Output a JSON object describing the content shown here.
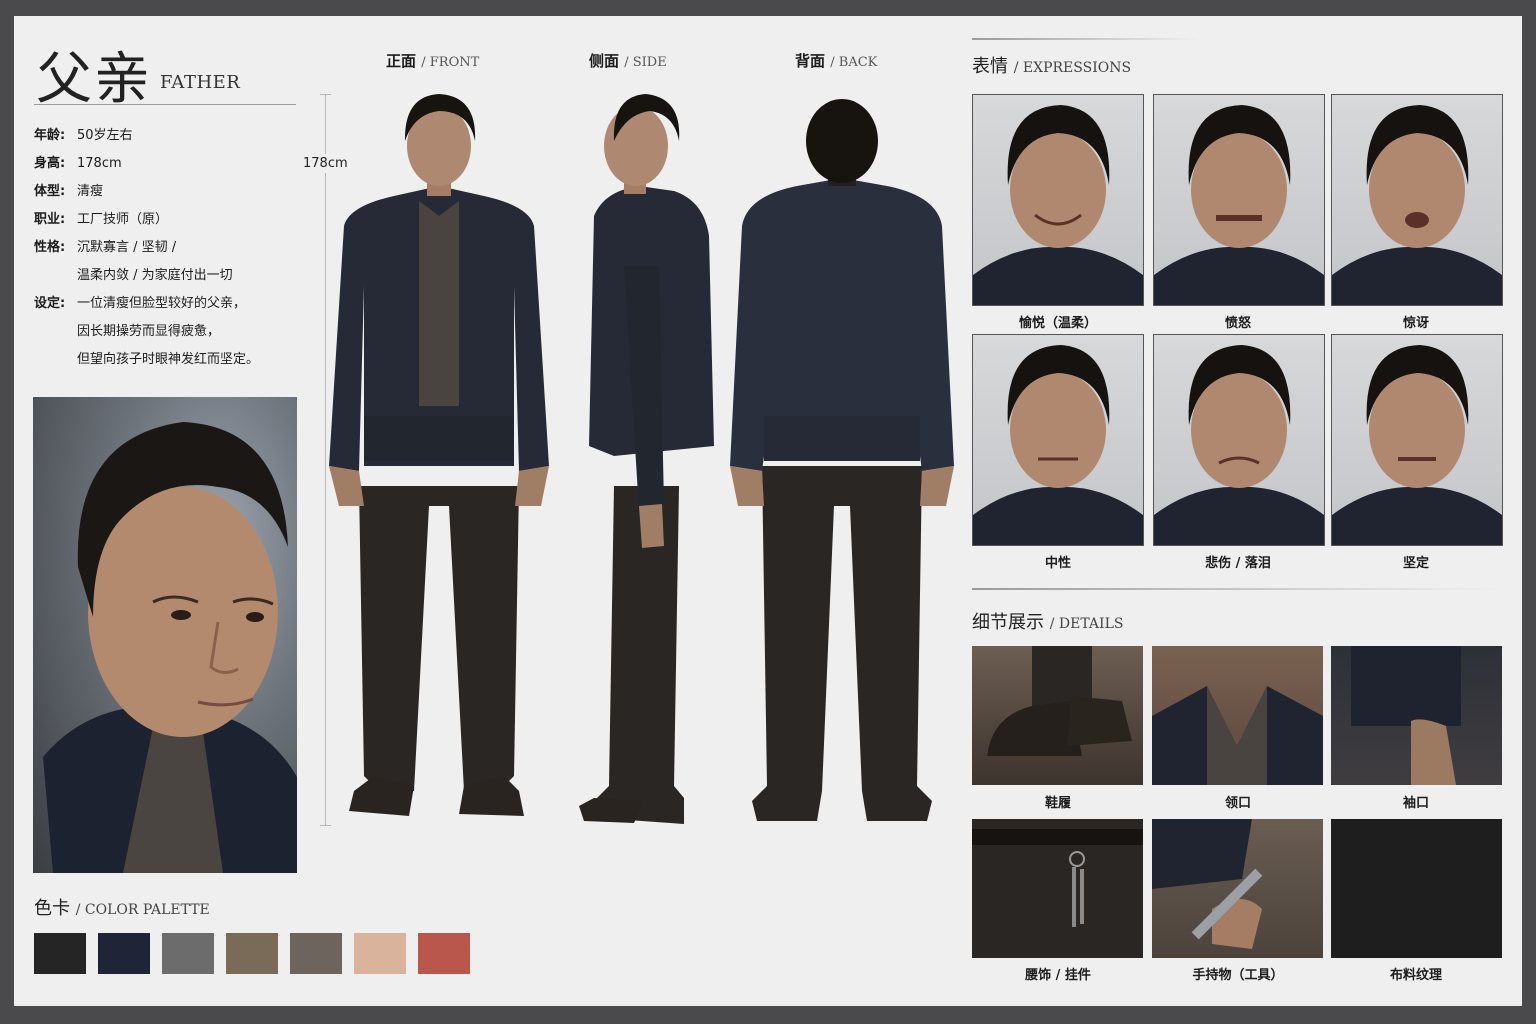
{
  "header": {
    "title_cn": "父亲",
    "title_en": "FATHER"
  },
  "info": [
    {
      "label": "年龄:",
      "lines": [
        "50岁左右"
      ]
    },
    {
      "label": "身高:",
      "lines": [
        "178cm"
      ]
    },
    {
      "label": "体型:",
      "lines": [
        "清瘦"
      ]
    },
    {
      "label": "职业:",
      "lines": [
        "工厂技师（原）"
      ]
    },
    {
      "label": "性格:",
      "lines": [
        "沉默寡言 / 坚韧 /",
        "温柔内敛 / 为家庭付出一切"
      ]
    },
    {
      "label": "设定:",
      "lines": [
        "一位清瘦但脸型较好的父亲，",
        "因长期操劳而显得疲惫，",
        "但望向孩子时眼神发红而坚定。"
      ]
    }
  ],
  "views": {
    "front": {
      "cn": "正面",
      "en": "FRONT"
    },
    "side": {
      "cn": "侧面",
      "en": "SIDE"
    },
    "back": {
      "cn": "背面",
      "en": "BACK"
    },
    "height_label": "178cm"
  },
  "palette": {
    "title_cn": "色卡",
    "title_en": "COLOR PALETTE",
    "colors": [
      "#252525",
      "#1f2536",
      "#6c6c6c",
      "#7a6a58",
      "#6d645d",
      "#d9b39c",
      "#b9574c"
    ]
  },
  "expressions": {
    "title_cn": "表情",
    "title_en": "EXPRESSIONS",
    "items": [
      "愉悦（温柔）",
      "愤怒",
      "惊讶",
      "中性",
      "悲伤 / 落泪",
      "坚定"
    ]
  },
  "details": {
    "title_cn": "细节展示",
    "title_en": "DETAILS",
    "items": [
      "鞋履",
      "领口",
      "袖口",
      "腰饰 / 挂件",
      "手持物（工具）",
      "布料纹理"
    ]
  }
}
